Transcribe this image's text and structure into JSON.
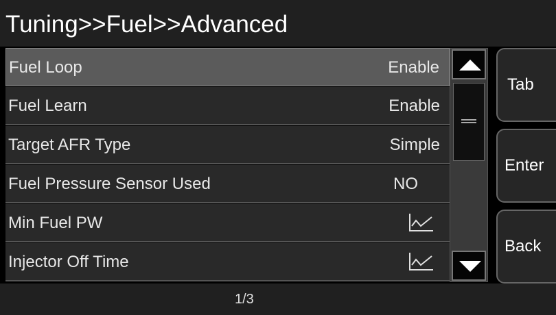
{
  "header": {
    "title": "Tuning>>Fuel>>Advanced"
  },
  "list": {
    "items": [
      {
        "label": "Fuel Loop",
        "value": "Enable",
        "kind": "text",
        "selected": true
      },
      {
        "label": "Fuel Learn",
        "value": "Enable",
        "kind": "text",
        "selected": false
      },
      {
        "label": "Target AFR Type",
        "value": "Simple",
        "kind": "text",
        "selected": false
      },
      {
        "label": "Fuel Pressure Sensor Used",
        "value": "NO",
        "kind": "text",
        "selected": false
      },
      {
        "label": "Min Fuel PW",
        "value": null,
        "kind": "graph-icon",
        "selected": false
      },
      {
        "label": "Injector Off Time",
        "value": null,
        "kind": "graph-icon",
        "selected": false
      }
    ]
  },
  "scrollbar": {
    "up_icon": "triangle-up-icon",
    "down_icon": "triangle-down-icon"
  },
  "side_buttons": {
    "tab": "Tab",
    "enter": "Enter",
    "back": "Back"
  },
  "status": {
    "page": "1/3"
  },
  "colors": {
    "background": "#000000",
    "bar": "#202020",
    "row": "#292929",
    "selected_row": "#5b5b5b"
  }
}
